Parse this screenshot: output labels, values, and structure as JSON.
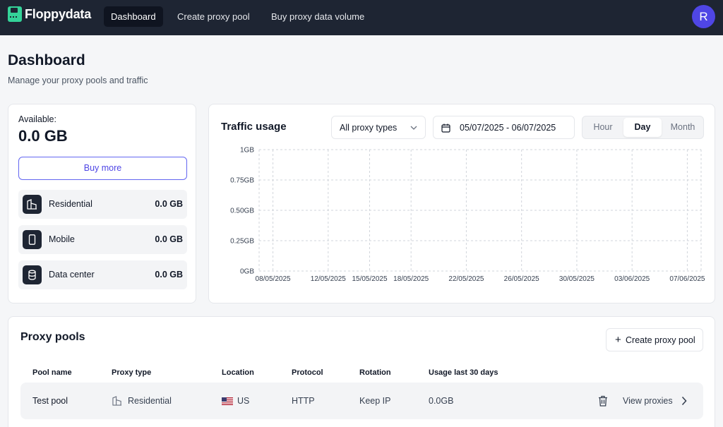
{
  "nav": {
    "brand": "Floppydata",
    "links": [
      {
        "label": "Dashboard",
        "active": true
      },
      {
        "label": "Create proxy pool",
        "active": false
      },
      {
        "label": "Buy proxy data volume",
        "active": false
      }
    ],
    "avatar_initial": "R",
    "colors": {
      "bar": "#1e2533",
      "avatar": "#4f46e5",
      "logo": "#34d399"
    }
  },
  "header": {
    "title": "Dashboard",
    "subtitle": "Manage your proxy pools and traffic"
  },
  "available": {
    "label": "Available:",
    "value": "0.0 GB",
    "buy_more_label": "Buy more",
    "types": [
      {
        "name": "Residential",
        "value": "0.0 GB",
        "icon": "building-icon"
      },
      {
        "name": "Mobile",
        "value": "0.0 GB",
        "icon": "smartphone-icon"
      },
      {
        "name": "Data center",
        "value": "0.0 GB",
        "icon": "database-icon"
      }
    ]
  },
  "traffic": {
    "title": "Traffic usage",
    "proxy_type_select": "All proxy types",
    "date_range": "05/07/2025 - 06/07/2025",
    "granularity": [
      {
        "label": "Hour",
        "active": false
      },
      {
        "label": "Day",
        "active": true
      },
      {
        "label": "Month",
        "active": false
      }
    ]
  },
  "chart_data": {
    "type": "line",
    "title": "",
    "xlabel": "",
    "ylabel": "",
    "y_ticks": [
      "0GB",
      "0.25GB",
      "0.50GB",
      "0.75GB",
      "1GB"
    ],
    "ylim": [
      0,
      1
    ],
    "x_ticks": [
      "08/05/2025",
      "12/05/2025",
      "15/05/2025",
      "18/05/2025",
      "22/05/2025",
      "26/05/2025",
      "30/05/2025",
      "03/06/2025",
      "07/06/2025"
    ],
    "x_tick_days": [
      1,
      5,
      8,
      11,
      15,
      19,
      23,
      27,
      31
    ],
    "x_range_days": [
      0,
      32
    ],
    "series": [],
    "grid": true
  },
  "pools": {
    "title": "Proxy pools",
    "create_label": "Create proxy pool",
    "columns": [
      "Pool name",
      "Proxy type",
      "Location",
      "Protocol",
      "Rotation",
      "Usage last 30 days"
    ],
    "rows": [
      {
        "name": "Test pool",
        "proxy_type": "Residential",
        "location": "US",
        "protocol": "HTTP",
        "rotation": "Keep IP",
        "usage": "0.0GB",
        "view_label": "View proxies"
      }
    ]
  }
}
